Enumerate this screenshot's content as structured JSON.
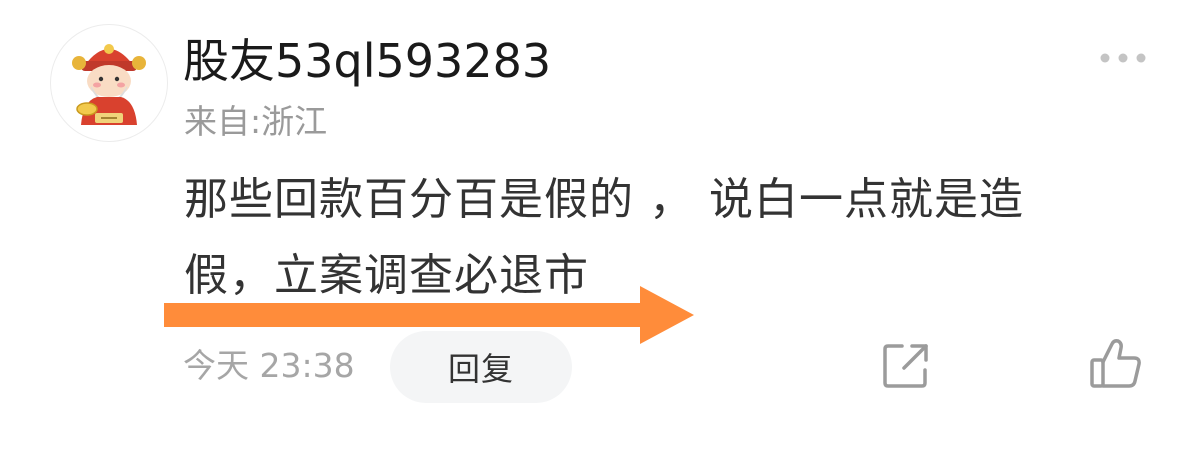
{
  "comment": {
    "author": {
      "name": "股友53ql593283",
      "location": "来自:浙江",
      "avatar_icon": "fortune-god-avatar"
    },
    "content_lines": [
      "那些回款百分百是假的 ， 说白一点就是造",
      "假，立案调查必退市"
    ],
    "time": "今天 23:38",
    "reply_label": "回复",
    "icons": {
      "more": "more-dots-icon",
      "share": "share-icon",
      "like": "thumbs-up-icon"
    }
  },
  "annotation": {
    "type": "arrow-right",
    "color": "#ff8c3a"
  },
  "colors": {
    "username": "#1a1a1a",
    "secondary_text": "#9a9a9a",
    "body_text": "#333333",
    "reply_button_bg": "#f4f5f6",
    "icon_gray": "#9b9b9b"
  }
}
